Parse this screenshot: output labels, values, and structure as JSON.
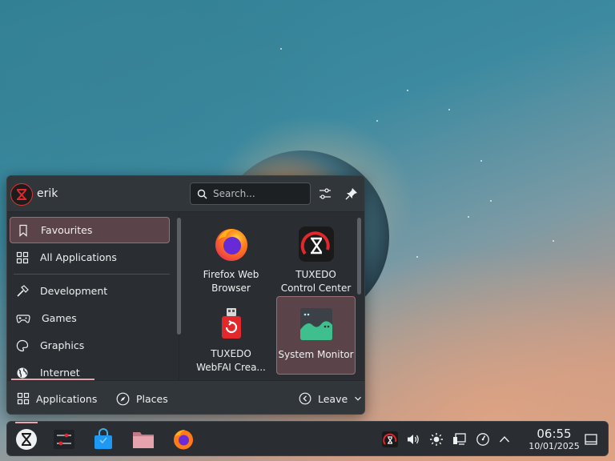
{
  "launcher": {
    "user": {
      "name": "erik"
    },
    "search": {
      "placeholder": "Search..."
    },
    "sidebar": {
      "items": [
        {
          "label": "Favourites",
          "icon": "bookmark-icon",
          "active": true
        },
        {
          "label": "All Applications",
          "icon": "grid-icon"
        },
        {
          "label": "Development",
          "icon": "hammer-icon"
        },
        {
          "label": "Games",
          "icon": "gamepad-icon"
        },
        {
          "label": "Graphics",
          "icon": "palette-icon"
        },
        {
          "label": "Internet",
          "icon": "globe-icon"
        }
      ]
    },
    "apps": [
      {
        "label": "Firefox Web Browser",
        "icon": "firefox-icon"
      },
      {
        "label": "TUXEDO Control Center",
        "icon": "tuxedo-control-center-icon"
      },
      {
        "label": "TUXEDO WebFAI Crea...",
        "icon": "usb-restore-icon"
      },
      {
        "label": "System Monitor",
        "icon": "system-monitor-icon",
        "active": true
      }
    ],
    "footer": {
      "applications_label": "Applications",
      "places_label": "Places",
      "leave_label": "Leave"
    }
  },
  "taskbar": {
    "clock": {
      "time": "06:55",
      "date": "10/01/2025"
    }
  },
  "colors": {
    "accent": "#e8a5ad",
    "highlight_bg": "#5a4349",
    "panel_bg": "#2a2e32",
    "tuxedo_red": "#e0282d"
  }
}
